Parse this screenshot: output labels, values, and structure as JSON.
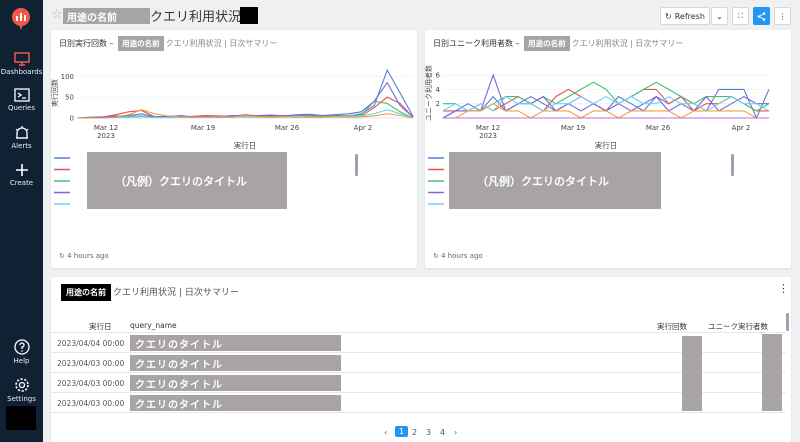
{
  "sidebar": {
    "items": [
      {
        "label": "Dashboards"
      },
      {
        "label": "Queries"
      },
      {
        "label": "Alerts"
      },
      {
        "label": "Create"
      },
      {
        "label": "Help"
      },
      {
        "label": "Settings"
      }
    ]
  },
  "header": {
    "title_redacted": "用途の名前",
    "title": "クエリ利用状況",
    "refresh_label": "Refresh"
  },
  "widget1": {
    "title_prefix": "日別実行回数 –",
    "tag": "用途の名前",
    "title_suffix": "クエリ利用状況",
    "title_sep": "|",
    "title_end": "日次サマリー",
    "legend_redacted": "（凡例）クエリのタイトル",
    "updated": "4 hours ago"
  },
  "widget2": {
    "title_prefix": "日別ユニーク利用者数 –",
    "tag": "用途の名前",
    "title_suffix": "クエリ利用状況",
    "title_sep": "|",
    "title_end": "日次サマリー",
    "legend_redacted": "（凡例）クエリのタイトル",
    "updated": "4 hours ago"
  },
  "table": {
    "tag": "用途の名前",
    "title_suffix": "クエリ利用状況",
    "title_sep": "|",
    "title_end": "日次サマリー",
    "columns": [
      "実行日",
      "query_name",
      "実行回数",
      "ユニーク実行者数"
    ],
    "rows": [
      {
        "date": "2023/04/04 00:00",
        "query": "クエリのタイトル"
      },
      {
        "date": "2023/04/03 00:00",
        "query": "クエリのタイトル"
      },
      {
        "date": "2023/04/03 00:00",
        "query": "クエリのタイトル"
      },
      {
        "date": "2023/04/03 00:00",
        "query": "クエリのタイトル"
      }
    ],
    "pages": [
      "1",
      "2",
      "3",
      "4"
    ],
    "prev": "‹",
    "next": "›"
  },
  "colors": {
    "sidebar": "#0f2133",
    "accent": "#2196f3",
    "redact": "#a8a4a4",
    "logo": "#ef5a46"
  },
  "chart_data": [
    {
      "type": "line",
      "xlabel": "実行日",
      "ylabel": "実行回数",
      "yticks": [
        0,
        50,
        100
      ],
      "ylim": [
        0,
        120
      ],
      "xticks": [
        "Mar 12\n2023",
        "Mar 19",
        "Mar 26",
        "Apr 2"
      ],
      "x": [
        0,
        1,
        2,
        3,
        4,
        5,
        6,
        7,
        8,
        9,
        10,
        11,
        12,
        13,
        14,
        15,
        16,
        17,
        18,
        19,
        20,
        21,
        22,
        23,
        24,
        25,
        26
      ],
      "series": [
        {
          "color": "#5b7bd8",
          "values": [
            0,
            2,
            3,
            5,
            2,
            4,
            2,
            3,
            6,
            2,
            3,
            4,
            5,
            4,
            3,
            5,
            4,
            6,
            5,
            4,
            6,
            5,
            10,
            30,
            115,
            60,
            4
          ]
        },
        {
          "color": "#e05656",
          "values": [
            0,
            0,
            2,
            8,
            15,
            18,
            3,
            2,
            2,
            4,
            6,
            5,
            4,
            8,
            5,
            4,
            6,
            5,
            4,
            3,
            5,
            4,
            5,
            25,
            50,
            35,
            2
          ]
        },
        {
          "color": "#45c06a",
          "values": [
            0,
            0,
            1,
            3,
            4,
            5,
            2,
            2,
            3,
            2,
            3,
            2,
            3,
            5,
            4,
            3,
            5,
            6,
            7,
            5,
            4,
            6,
            8,
            40,
            35,
            15,
            0
          ]
        },
        {
          "color": "#7a66d8",
          "values": [
            0,
            1,
            2,
            4,
            6,
            10,
            3,
            4,
            5,
            3,
            4,
            3,
            6,
            5,
            6,
            7,
            5,
            8,
            9,
            6,
            8,
            10,
            15,
            40,
            85,
            30,
            2
          ]
        },
        {
          "color": "#6ad4f0",
          "values": [
            0,
            0,
            0,
            1,
            2,
            3,
            1,
            1,
            2,
            1,
            2,
            1,
            2,
            3,
            2,
            2,
            3,
            4,
            3,
            2,
            3,
            4,
            5,
            10,
            20,
            10,
            0
          ]
        },
        {
          "color": "#f0a040",
          "values": [
            0,
            0,
            0,
            2,
            8,
            20,
            10,
            5,
            3,
            2,
            2,
            3,
            2,
            6,
            3,
            2,
            3,
            2,
            2,
            2,
            3,
            2,
            3,
            5,
            10,
            6,
            0
          ]
        }
      ]
    },
    {
      "type": "line",
      "xlabel": "実行日",
      "ylabel": "ユニーク利用者数",
      "yticks": [
        2,
        4,
        6
      ],
      "ylim": [
        0,
        7
      ],
      "xticks": [
        "Mar 12\n2023",
        "Mar 19",
        "Mar 26",
        "Apr 2"
      ],
      "x": [
        0,
        1,
        2,
        3,
        4,
        5,
        6,
        7,
        8,
        9,
        10,
        11,
        12,
        13,
        14,
        15,
        16,
        17,
        18,
        19,
        20,
        21,
        22,
        23,
        24,
        25,
        26
      ],
      "series": [
        {
          "color": "#5b7bd8",
          "values": [
            0,
            1,
            2,
            1,
            3,
            1,
            2,
            3,
            2,
            1,
            2,
            3,
            2,
            1,
            3,
            2,
            1,
            3,
            2,
            3,
            2,
            1,
            4,
            4,
            4,
            0,
            4
          ]
        },
        {
          "color": "#e05656",
          "values": [
            1,
            1,
            1,
            2,
            1,
            2,
            3,
            2,
            1,
            3,
            4,
            3,
            2,
            1,
            2,
            3,
            4,
            4,
            2,
            3,
            1,
            2,
            2,
            3,
            2,
            1,
            1
          ]
        },
        {
          "color": "#45c06a",
          "values": [
            2,
            2,
            1,
            1,
            2,
            3,
            3,
            2,
            3,
            2,
            3,
            4,
            5,
            4,
            2,
            3,
            4,
            5,
            4,
            3,
            2,
            3,
            3,
            3,
            2,
            1,
            2
          ]
        },
        {
          "color": "#7a66d8",
          "values": [
            0,
            1,
            1,
            1,
            6,
            1,
            2,
            2,
            3,
            1,
            2,
            1,
            2,
            1,
            2,
            1,
            2,
            3,
            1,
            2,
            1,
            3,
            1,
            2,
            3,
            2,
            2
          ]
        },
        {
          "color": "#6ad4f0",
          "values": [
            1,
            2,
            1,
            2,
            1,
            3,
            2,
            2,
            1,
            2,
            2,
            3,
            2,
            3,
            2,
            3,
            2,
            2,
            3,
            2,
            2,
            1,
            2,
            3,
            2,
            2,
            1
          ]
        },
        {
          "color": "#f0a040",
          "values": [
            0,
            0,
            1,
            1,
            2,
            1,
            1,
            0,
            1,
            1,
            1,
            0,
            1,
            1,
            0,
            1,
            1,
            1,
            1,
            0,
            1,
            1,
            1,
            1,
            1,
            0,
            0
          ]
        },
        {
          "color": "#c86ad8",
          "values": [
            0,
            0,
            0,
            0,
            0,
            0,
            0,
            0,
            0,
            0,
            0,
            0,
            0,
            0,
            0,
            0,
            0,
            0,
            0,
            0,
            0,
            0,
            0,
            0,
            0,
            0,
            0
          ]
        }
      ]
    }
  ]
}
